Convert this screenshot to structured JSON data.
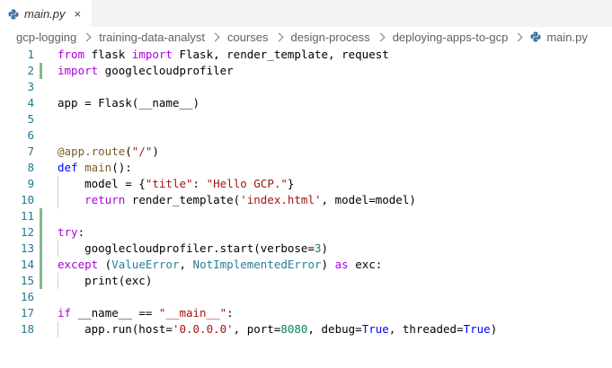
{
  "tab": {
    "filename": "main.py",
    "close_symbol": "×",
    "icon": "python-icon"
  },
  "breadcrumb": {
    "items": [
      "gcp-logging",
      "training-data-analyst",
      "courses",
      "design-process",
      "deploying-apps-to-gcp"
    ],
    "file": "main.py",
    "separator_icon": "chevron-right-icon"
  },
  "colors": {
    "keyword": "#0000ff",
    "control": "#af00db",
    "string": "#a31515",
    "number": "#098658",
    "function": "#795e26",
    "class": "#267f99",
    "line_number": "#237893",
    "modified_gutter": "#81b88b"
  },
  "code": {
    "lines": [
      {
        "n": "1",
        "mod": false,
        "tokens": [
          [
            "kw2",
            "from"
          ],
          [
            "t",
            " flask "
          ],
          [
            "kw2",
            "import"
          ],
          [
            "t",
            " Flask, render_template, request"
          ]
        ]
      },
      {
        "n": "2",
        "mod": true,
        "tokens": [
          [
            "kw2",
            "import"
          ],
          [
            "t",
            " googlecloudprofiler"
          ]
        ]
      },
      {
        "n": "3",
        "mod": false,
        "tokens": []
      },
      {
        "n": "4",
        "mod": false,
        "tokens": [
          [
            "t",
            "app = Flask(__name__)"
          ]
        ]
      },
      {
        "n": "5",
        "mod": false,
        "tokens": []
      },
      {
        "n": "6",
        "mod": false,
        "tokens": []
      },
      {
        "n": "7",
        "mod": false,
        "tokens": [
          [
            "dec",
            "@app.route"
          ],
          [
            "t",
            "("
          ],
          [
            "str",
            "\"/\""
          ],
          [
            "t",
            ")"
          ]
        ]
      },
      {
        "n": "8",
        "mod": false,
        "tokens": [
          [
            "kw",
            "def"
          ],
          [
            "t",
            " "
          ],
          [
            "fn",
            "main"
          ],
          [
            "t",
            "():"
          ]
        ]
      },
      {
        "n": "9",
        "mod": false,
        "guide": true,
        "tokens": [
          [
            "t",
            "    model = {"
          ],
          [
            "str",
            "\"title\""
          ],
          [
            "t",
            ": "
          ],
          [
            "str",
            "\"Hello GCP.\""
          ],
          [
            "t",
            "}"
          ]
        ]
      },
      {
        "n": "10",
        "mod": false,
        "guide": true,
        "tokens": [
          [
            "t",
            "    "
          ],
          [
            "kw2",
            "return"
          ],
          [
            "t",
            " render_template("
          ],
          [
            "str",
            "'index.html'"
          ],
          [
            "t",
            ", model=model)"
          ]
        ]
      },
      {
        "n": "11",
        "mod": true,
        "tokens": []
      },
      {
        "n": "12",
        "mod": true,
        "tokens": [
          [
            "kw2",
            "try"
          ],
          [
            "t",
            ":"
          ]
        ]
      },
      {
        "n": "13",
        "mod": true,
        "guide": true,
        "tokens": [
          [
            "t",
            "    googlecloudprofiler.start(verbose="
          ],
          [
            "num",
            "3"
          ],
          [
            "t",
            ")"
          ]
        ]
      },
      {
        "n": "14",
        "mod": true,
        "tokens": [
          [
            "kw2",
            "except"
          ],
          [
            "t",
            " ("
          ],
          [
            "cls",
            "ValueError"
          ],
          [
            "t",
            ", "
          ],
          [
            "cls",
            "NotImplementedError"
          ],
          [
            "t",
            ") "
          ],
          [
            "kw2",
            "as"
          ],
          [
            "t",
            " exc:"
          ]
        ]
      },
      {
        "n": "15",
        "mod": true,
        "guide": true,
        "tokens": [
          [
            "t",
            "    print(exc)"
          ]
        ]
      },
      {
        "n": "16",
        "mod": false,
        "tokens": []
      },
      {
        "n": "17",
        "mod": false,
        "tokens": [
          [
            "kw2",
            "if"
          ],
          [
            "t",
            " __name__ == "
          ],
          [
            "str",
            "\"__main__\""
          ],
          [
            "t",
            ":"
          ]
        ]
      },
      {
        "n": "18",
        "mod": false,
        "guide": true,
        "tokens": [
          [
            "t",
            "    app.run(host="
          ],
          [
            "str",
            "'0.0.0.0'"
          ],
          [
            "t",
            ", port="
          ],
          [
            "num",
            "8080"
          ],
          [
            "t",
            ", debug="
          ],
          [
            "kw",
            "True"
          ],
          [
            "t",
            ", threaded="
          ],
          [
            "kw",
            "True"
          ],
          [
            "t",
            ")"
          ]
        ]
      }
    ]
  }
}
